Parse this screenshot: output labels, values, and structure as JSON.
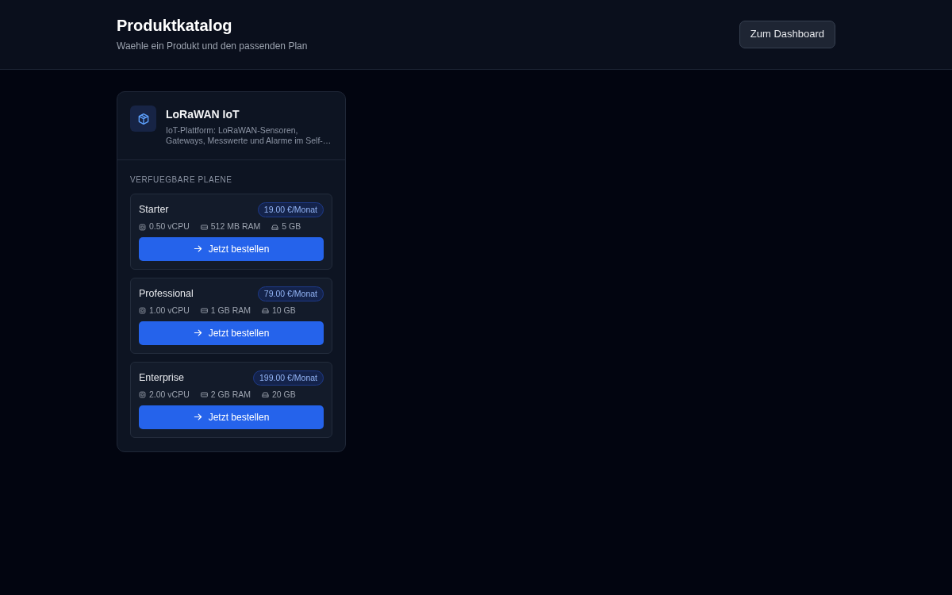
{
  "header": {
    "title": "Produktkatalog",
    "subtitle": "Waehle ein Produkt und den passenden Plan",
    "dashboard_button": "Zum Dashboard"
  },
  "products": [
    {
      "name": "LoRaWAN IoT",
      "description": "IoT-Plattform: LoRaWAN-Sensoren, Gateways, Messwerte und Alarme im Self-…",
      "plans_heading": "VERFUEGBARE PLAENE",
      "plans": [
        {
          "name": "Starter",
          "price": "19.00 €/Monat",
          "specs": [
            {
              "kind": "cpu",
              "text": "0.50 vCPU"
            },
            {
              "kind": "ram",
              "text": "512 MB RAM"
            },
            {
              "kind": "storage",
              "text": "5 GB"
            }
          ],
          "order_button": "Jetzt bestellen"
        },
        {
          "name": "Professional",
          "price": "79.00 €/Monat",
          "specs": [
            {
              "kind": "cpu",
              "text": "1.00 vCPU"
            },
            {
              "kind": "ram",
              "text": "1 GB RAM"
            },
            {
              "kind": "storage",
              "text": "10 GB"
            }
          ],
          "order_button": "Jetzt bestellen"
        },
        {
          "name": "Enterprise",
          "price": "199.00 €/Monat",
          "specs": [
            {
              "kind": "cpu",
              "text": "2.00 vCPU"
            },
            {
              "kind": "ram",
              "text": "2 GB RAM"
            },
            {
              "kind": "storage",
              "text": "20 GB"
            }
          ],
          "order_button": "Jetzt bestellen"
        }
      ]
    }
  ]
}
